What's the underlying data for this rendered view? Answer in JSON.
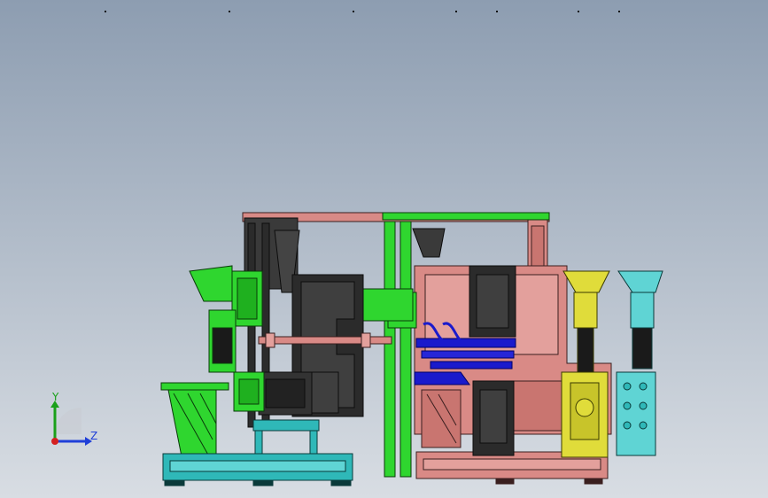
{
  "viewport": {
    "background_top": "#8d9db1",
    "background_bottom": "#d8dde3"
  },
  "triad": {
    "y_label": "Y",
    "z_label": "Z",
    "y_color": "#1aa01a",
    "z_color": "#1f3fd8",
    "x_color": "#d42020"
  },
  "model": {
    "parts": [
      {
        "name": "green-station",
        "color": "#2fd62f"
      },
      {
        "name": "dark-fixture",
        "color": "#2b2b2b"
      },
      {
        "name": "cyan-base-frame",
        "color": "#2fb8b8"
      },
      {
        "name": "pink-gantry",
        "color": "#d98a86"
      },
      {
        "name": "blue-manifold",
        "color": "#1a1acc"
      },
      {
        "name": "yellow-actuator",
        "color": "#e0dc3a"
      },
      {
        "name": "cyan-actuator",
        "color": "#5fd4d4"
      }
    ]
  }
}
